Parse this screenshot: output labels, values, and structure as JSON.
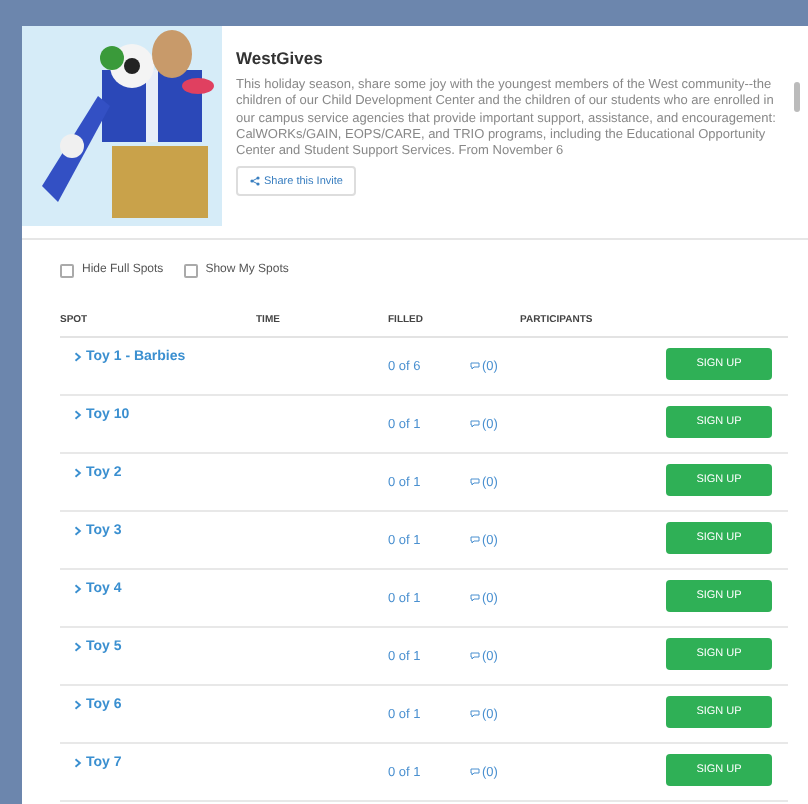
{
  "header": {
    "title": "WestGives",
    "description": "This holiday season, share some joy with the youngest members of the West community--the children of our Child Development Center and the children of our students who are enrolled in our campus service agencies that provide important support, assistance, and encouragement: CalWORKs/GAIN, EOPS/CARE, and TRIO programs, including the Educational Opportunity Center and Student Support Services. From November 6",
    "share_button": "Share this Invite"
  },
  "filters": [
    {
      "label": "Hide Full Spots",
      "checked": false
    },
    {
      "label": "Show My Spots",
      "checked": false
    }
  ],
  "table": {
    "columns": [
      "SPOT",
      "TIME",
      "FILLED",
      "PARTICIPANTS"
    ],
    "rows": [
      {
        "spot": "Toy 1 - Barbies",
        "filled": "0 of 6",
        "comments": "(0)",
        "action": "SIGN UP"
      },
      {
        "spot": "Toy 10",
        "filled": "0 of 1",
        "comments": "(0)",
        "action": "SIGN UP"
      },
      {
        "spot": "Toy 2",
        "filled": "0 of 1",
        "comments": "(0)",
        "action": "SIGN UP"
      },
      {
        "spot": "Toy 3",
        "filled": "0 of 1",
        "comments": "(0)",
        "action": "SIGN UP"
      },
      {
        "spot": "Toy 4",
        "filled": "0 of 1",
        "comments": "(0)",
        "action": "SIGN UP"
      },
      {
        "spot": "Toy 5",
        "filled": "0 of 1",
        "comments": "(0)",
        "action": "SIGN UP"
      },
      {
        "spot": "Toy 6",
        "filled": "0 of 1",
        "comments": "(0)",
        "action": "SIGN UP"
      },
      {
        "spot": "Toy 7",
        "filled": "0 of 1",
        "comments": "(0)",
        "action": "SIGN UP"
      }
    ]
  }
}
